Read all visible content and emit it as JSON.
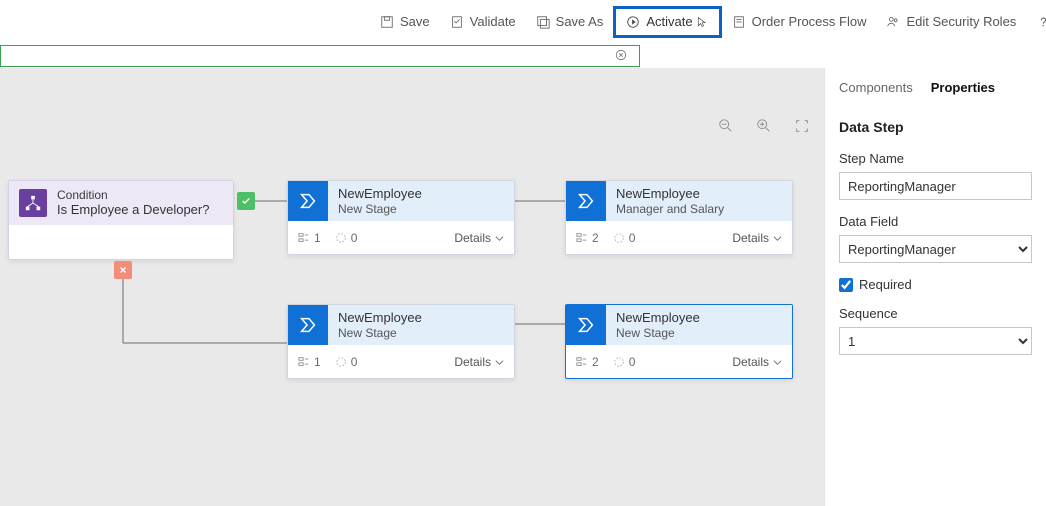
{
  "toolbar": {
    "save": "Save",
    "validate": "Validate",
    "save_as": "Save As",
    "activate": "Activate",
    "order": "Order Process Flow",
    "security": "Edit Security Roles",
    "help_prefix": "H",
    "help_suffix": "elp"
  },
  "canvas": {
    "condition": {
      "title": "Condition",
      "subtitle": "Is Employee a Developer?"
    },
    "stage1": {
      "line1": "NewEmployee",
      "line2": "New Stage",
      "count1": "1",
      "count2": "0",
      "details": "Details"
    },
    "stage2": {
      "line1": "NewEmployee",
      "line2": "Manager and Salary",
      "count1": "2",
      "count2": "0",
      "details": "Details"
    },
    "stage3": {
      "line1": "NewEmployee",
      "line2": "New Stage",
      "count1": "1",
      "count2": "0",
      "details": "Details"
    },
    "stage4": {
      "line1": "NewEmployee",
      "line2": "New Stage",
      "count1": "2",
      "count2": "0",
      "details": "Details"
    }
  },
  "side": {
    "tab_components": "Components",
    "tab_properties": "Properties",
    "section_title": "Data Step",
    "step_name_label": "Step Name",
    "step_name_value": "ReportingManager",
    "data_field_label": "Data Field",
    "data_field_value": "ReportingManager",
    "required_label": "Required",
    "sequence_label": "Sequence",
    "sequence_value": "1"
  }
}
